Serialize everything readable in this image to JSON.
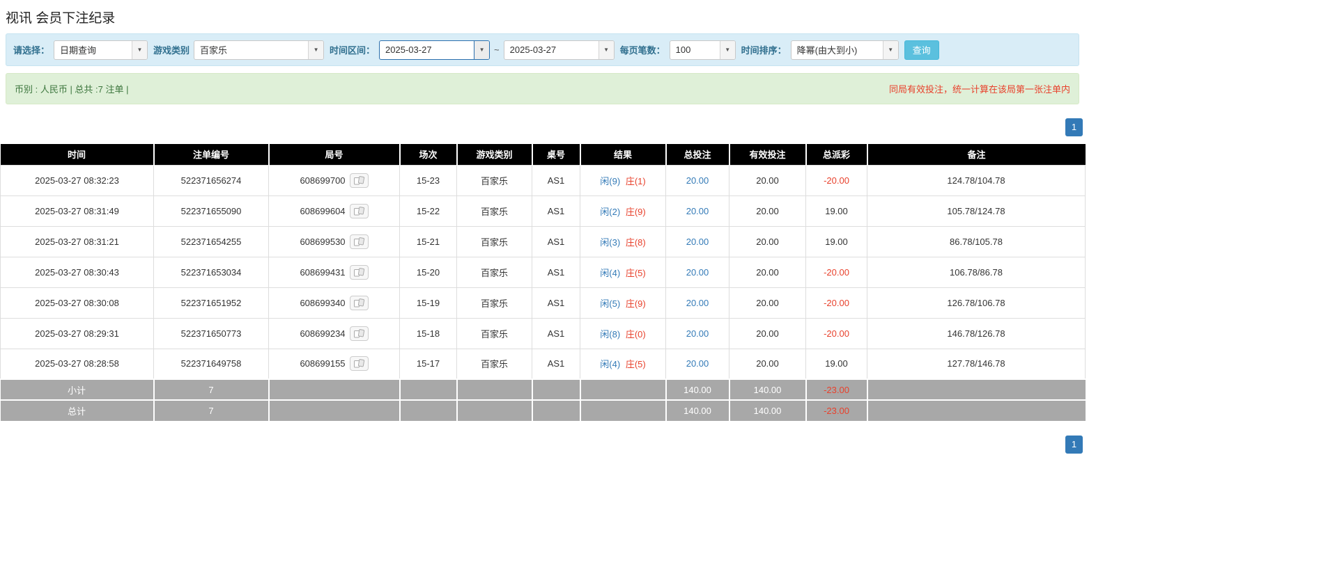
{
  "colors": {
    "link_blue": "#337ab7",
    "player_blue": "#337ab7",
    "banker_red": "#e8412c",
    "negative_red": "#e8412c",
    "notice_red": "#e8412c",
    "filter_bar_bg": "#d9edf7",
    "info_bar_bg": "#dff0d8",
    "table_header_bg": "#000000",
    "summary_row_bg": "#a8a8a8",
    "search_button_bg": "#5bc0de",
    "pagination_bg": "#337ab7"
  },
  "icons": {
    "chevron_down": "▼"
  },
  "page": {
    "title": "视讯 会员下注纪录"
  },
  "filter_bar": {
    "query_type": {
      "label": "请选择：",
      "value": "日期查询"
    },
    "game_type": {
      "label": "游戏类别",
      "value": "百家乐"
    },
    "date_range": {
      "label": "时间区间：",
      "from": "2025-03-27",
      "separator": "~",
      "to": "2025-03-27"
    },
    "page_size": {
      "label": "每页笔数：",
      "value": "100"
    },
    "sort": {
      "label": "时间排序：",
      "value": "降幂(由大到小)"
    },
    "search_button_label": "查询"
  },
  "info_bar": {
    "summary": "币别 : 人民币 | 总共 :7 注单 |",
    "notice": "同局有效投注，统一计算在该局第一张注单内"
  },
  "pagination": {
    "current_page": "1"
  },
  "table": {
    "headers": [
      "时间",
      "注单编号",
      "局号",
      "场次",
      "游戏类别",
      "桌号",
      "结果",
      "总投注",
      "有效投注",
      "总派彩",
      "备注"
    ],
    "rows": [
      {
        "time": "2025-03-27 08:32:23",
        "bet_id": "522371656274",
        "round": "608699700",
        "session": "15-23",
        "game": "百家乐",
        "table_no": "AS1",
        "result_player": "闲(9)",
        "result_banker": "庄(1)",
        "total_bet": "20.00",
        "valid_bet": "20.00",
        "payout": "-20.00",
        "remark": "124.78/104.78"
      },
      {
        "time": "2025-03-27 08:31:49",
        "bet_id": "522371655090",
        "round": "608699604",
        "session": "15-22",
        "game": "百家乐",
        "table_no": "AS1",
        "result_player": "闲(2)",
        "result_banker": "庄(9)",
        "total_bet": "20.00",
        "valid_bet": "20.00",
        "payout": "19.00",
        "remark": "105.78/124.78"
      },
      {
        "time": "2025-03-27 08:31:21",
        "bet_id": "522371654255",
        "round": "608699530",
        "session": "15-21",
        "game": "百家乐",
        "table_no": "AS1",
        "result_player": "闲(3)",
        "result_banker": "庄(8)",
        "total_bet": "20.00",
        "valid_bet": "20.00",
        "payout": "19.00",
        "remark": "86.78/105.78"
      },
      {
        "time": "2025-03-27 08:30:43",
        "bet_id": "522371653034",
        "round": "608699431",
        "session": "15-20",
        "game": "百家乐",
        "table_no": "AS1",
        "result_player": "闲(4)",
        "result_banker": "庄(5)",
        "total_bet": "20.00",
        "valid_bet": "20.00",
        "payout": "-20.00",
        "remark": "106.78/86.78"
      },
      {
        "time": "2025-03-27 08:30:08",
        "bet_id": "522371651952",
        "round": "608699340",
        "session": "15-19",
        "game": "百家乐",
        "table_no": "AS1",
        "result_player": "闲(5)",
        "result_banker": "庄(9)",
        "total_bet": "20.00",
        "valid_bet": "20.00",
        "payout": "-20.00",
        "remark": "126.78/106.78"
      },
      {
        "time": "2025-03-27 08:29:31",
        "bet_id": "522371650773",
        "round": "608699234",
        "session": "15-18",
        "game": "百家乐",
        "table_no": "AS1",
        "result_player": "闲(8)",
        "result_banker": "庄(0)",
        "total_bet": "20.00",
        "valid_bet": "20.00",
        "payout": "-20.00",
        "remark": "146.78/126.78"
      },
      {
        "time": "2025-03-27 08:28:58",
        "bet_id": "522371649758",
        "round": "608699155",
        "session": "15-17",
        "game": "百家乐",
        "table_no": "AS1",
        "result_player": "闲(4)",
        "result_banker": "庄(5)",
        "total_bet": "20.00",
        "valid_bet": "20.00",
        "payout": "19.00",
        "remark": "127.78/146.78"
      }
    ],
    "subtotal": {
      "label": "小计",
      "count": "7",
      "total_bet": "140.00",
      "valid_bet": "140.00",
      "payout": "-23.00"
    },
    "total": {
      "label": "总计",
      "count": "7",
      "total_bet": "140.00",
      "valid_bet": "140.00",
      "payout": "-23.00"
    }
  }
}
